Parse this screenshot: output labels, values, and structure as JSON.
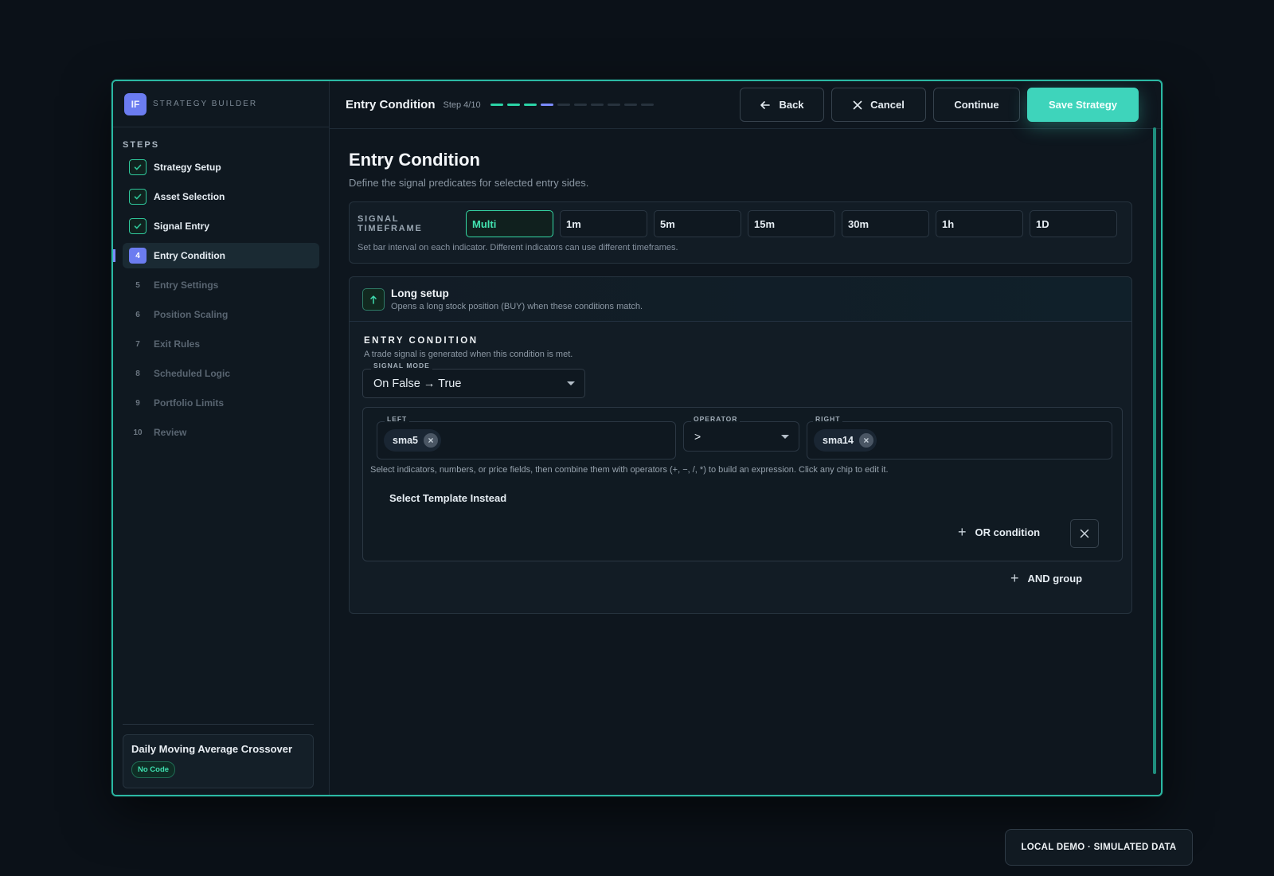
{
  "brand": {
    "logo": "IF",
    "name": "STRATEGY BUILDER"
  },
  "sidebar": {
    "steps_title": "STEPS",
    "steps": [
      {
        "num": "1",
        "label": "Strategy Setup",
        "status": "done"
      },
      {
        "num": "2",
        "label": "Asset Selection",
        "status": "done"
      },
      {
        "num": "3",
        "label": "Signal Entry",
        "status": "done"
      },
      {
        "num": "4",
        "label": "Entry Condition",
        "status": "current"
      },
      {
        "num": "5",
        "label": "Entry Settings",
        "status": "todo"
      },
      {
        "num": "6",
        "label": "Position Scaling",
        "status": "todo"
      },
      {
        "num": "7",
        "label": "Exit Rules",
        "status": "todo"
      },
      {
        "num": "8",
        "label": "Scheduled Logic",
        "status": "todo"
      },
      {
        "num": "9",
        "label": "Portfolio Limits",
        "status": "todo"
      },
      {
        "num": "10",
        "label": "Review",
        "status": "todo"
      }
    ],
    "strategy": {
      "name": "Daily Moving Average Crossover",
      "badge": "No Code"
    }
  },
  "topbar": {
    "title": "Entry Condition",
    "step_text": "Step 4/10",
    "progress": {
      "completed": 3,
      "current": 4,
      "total": 10
    },
    "back_label": "Back",
    "cancel_label": "Cancel",
    "continue_label": "Continue",
    "save_label": "Save Strategy"
  },
  "page": {
    "title": "Entry Condition",
    "subtitle": "Define the signal predicates for selected entry sides."
  },
  "timeframe": {
    "label": "SIGNAL TIMEFRAME",
    "options": [
      "Multi",
      "1m",
      "5m",
      "15m",
      "30m",
      "1h",
      "1D"
    ],
    "selected": "Multi",
    "hint": "Set bar interval on each indicator. Different indicators can use different timeframes."
  },
  "setup": {
    "icon": "arrow-up-icon",
    "title": "Long setup",
    "subtitle": "Opens a long stock position (BUY) when these conditions match.",
    "condition_title": "ENTRY CONDITION",
    "condition_subtitle": "A trade signal is generated when this condition is met.",
    "signal_mode_label": "SIGNAL MODE",
    "signal_mode_value": "On False → True",
    "left_label": "LEFT",
    "left_chip": "sma5",
    "operator_label": "OPERATOR",
    "operator_value": ">",
    "right_label": "RIGHT",
    "right_chip": "sma14",
    "hint": "Select indicators, numbers, or price fields, then combine them with operators (+, −, /, *) to build an expression. Click any chip to edit it.",
    "template_link": "Select Template Instead",
    "or_label": "OR condition",
    "and_label": "AND group"
  },
  "footer_badge": "LOCAL DEMO · SIMULATED DATA",
  "colors": {
    "accent": "#3ed4bb",
    "success": "#2fc79a",
    "current": "#6b7cf0"
  }
}
